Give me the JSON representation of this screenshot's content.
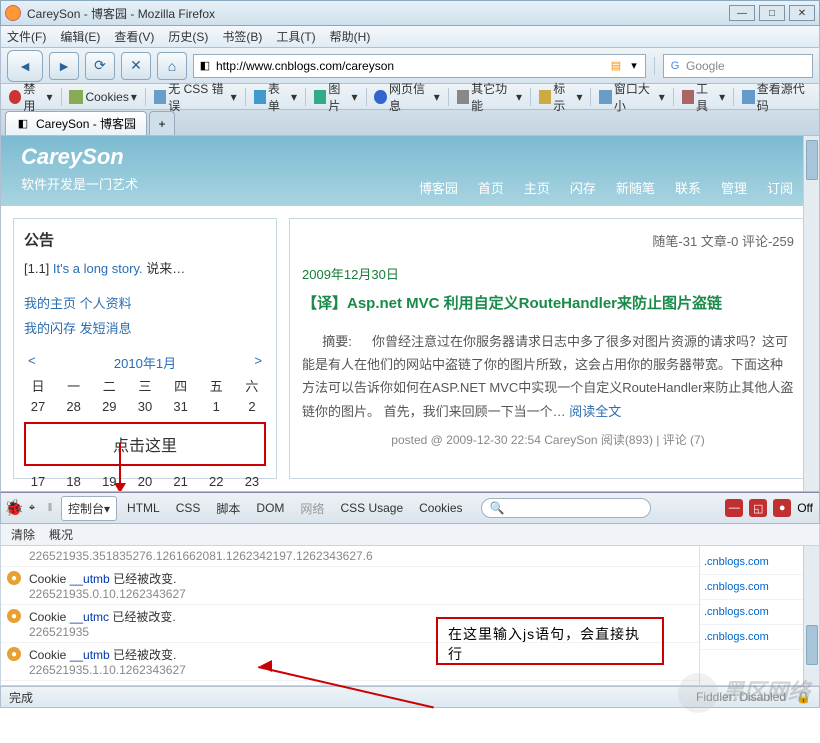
{
  "window": {
    "title": "CareySon - 博客园 - Mozilla Firefox"
  },
  "menu": [
    "文件(F)",
    "编辑(E)",
    "查看(V)",
    "历史(S)",
    "书签(B)",
    "工具(T)",
    "帮助(H)"
  ],
  "url": "http://www.cnblogs.com/careyson",
  "search_placeholder": "Google",
  "toolbar2": [
    "禁用",
    "Cookies",
    "无 CSS 错误",
    "表单",
    "图片",
    "网页信息",
    "其它功能",
    "标示",
    "窗口大小",
    "工具",
    "查看源代码"
  ],
  "tab_title": "CareySon - 博客园",
  "header": {
    "title": "CareySon",
    "subtitle": "软件开发是一门艺术"
  },
  "topnav": [
    "博客园",
    "首页",
    "主页",
    "闪存",
    "新随笔",
    "联系",
    "管理",
    "订阅"
  ],
  "sidebar": {
    "h": "公告",
    "line1a": "[1.1]",
    "line1b": "It's a long story.",
    "line1c": "说来…",
    "l2a": "我的主页",
    "l2b": "个人资料",
    "l3a": "我的闪存",
    "l3b": "发短消息",
    "cal_title": "2010年1月",
    "days": [
      "日",
      "一",
      "二",
      "三",
      "四",
      "五",
      "六"
    ],
    "click_here": "点击这里"
  },
  "main": {
    "meta": "随笔-31  文章-0  评论-259",
    "date": "2009年12月30日",
    "title": "【译】Asp.net MVC 利用自定义RouteHandler来防止图片盗链",
    "sum_label": "摘要:",
    "summary": "你曾经注意过在你服务器请求日志中多了很多对图片资源的请求吗？这可能是有人在他们的网站中盗链了你的图片所致，这会占用你的服务器带宽。下面这种方法可以告诉你如何在ASP.NET MVC中实现一个自定义RouteHandler来防止其他人盗链你的图片。      首先，我们来回顾一下当一个…",
    "readmore": "阅读全文",
    "footer": "posted @ 2009-12-30 22:54 CareySon 阅读(893) | 评论 (7)"
  },
  "firebug": {
    "tabs": {
      "console": "控制台",
      "html": "HTML",
      "css": "CSS",
      "script": "脚本",
      "dom": "DOM",
      "net": "网络",
      "cssusage": "CSS Usage",
      "cookies": "Cookies"
    },
    "off": "Off",
    "sub": [
      "清除",
      "概况"
    ],
    "rows": [
      {
        "t": "",
        "s": "226521935.351835276.1261662081.1262342197.1262343627.6"
      },
      {
        "t": "Cookie __utmb 已经被改变.",
        "s": "226521935.0.10.1262343627"
      },
      {
        "t": "Cookie __utmc 已经被改变.",
        "s": "226521935"
      },
      {
        "t": "Cookie __utmb 已经被改变.",
        "s": "226521935.1.10.1262343627"
      }
    ],
    "prompt": ">>>",
    "domains": [
      ".cnblogs.com",
      ".cnblogs.com",
      ".cnblogs.com",
      ".cnblogs.com"
    ]
  },
  "annot": {
    "js_input": "在这里输入js语句，会直接执行"
  },
  "status": {
    "done": "完成",
    "fiddler": "Fiddler: Disabled"
  },
  "watermark": "黑区网络"
}
